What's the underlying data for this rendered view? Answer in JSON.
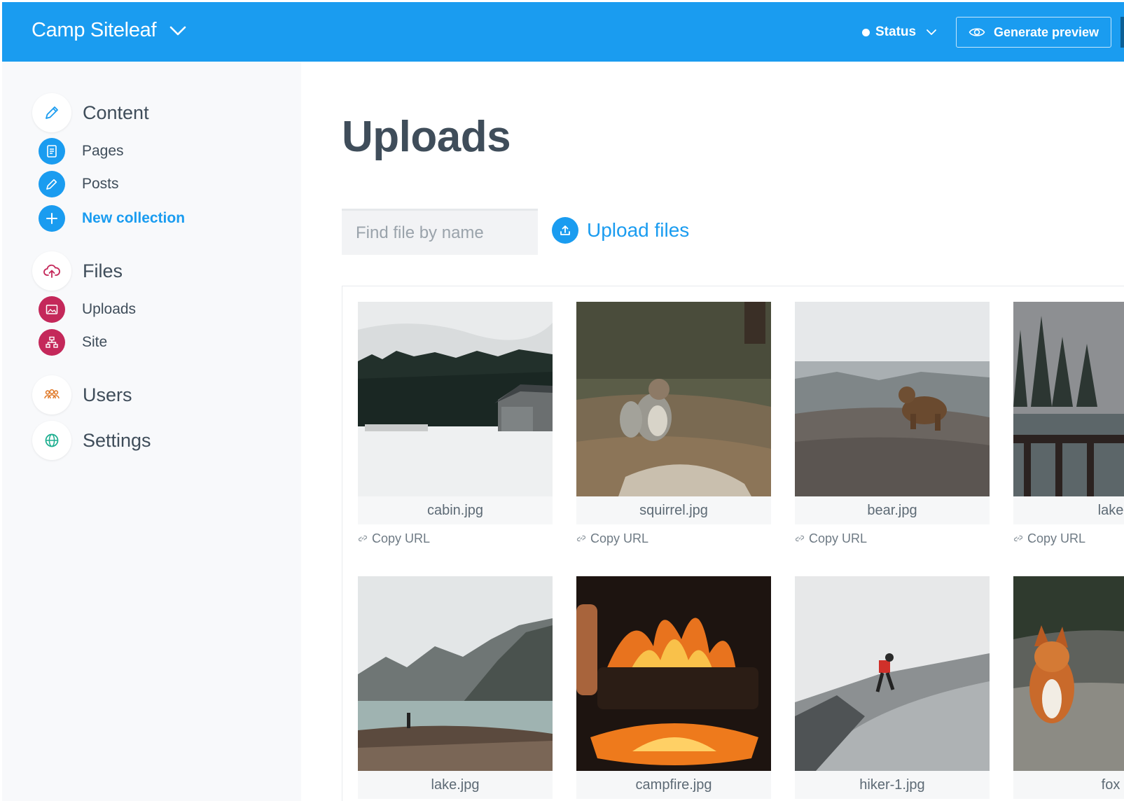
{
  "topbar": {
    "site_name": "Camp Siteleaf",
    "status_label": "Status",
    "preview_label": "Generate preview"
  },
  "sidebar": {
    "content": {
      "label": "Content",
      "items": [
        {
          "label": "Pages"
        },
        {
          "label": "Posts"
        },
        {
          "label": "New collection"
        }
      ]
    },
    "files": {
      "label": "Files",
      "items": [
        {
          "label": "Uploads"
        },
        {
          "label": "Site"
        }
      ]
    },
    "users": {
      "label": "Users"
    },
    "settings": {
      "label": "Settings"
    }
  },
  "main": {
    "title": "Uploads",
    "search_placeholder": "Find file by name",
    "upload_label": "Upload files",
    "copy_url_label": "Copy URL",
    "files": [
      {
        "name": "cabin.jpg"
      },
      {
        "name": "squirrel.jpg"
      },
      {
        "name": "bear.jpg"
      },
      {
        "name": "lake"
      },
      {
        "name": "lake.jpg"
      },
      {
        "name": "campfire.jpg"
      },
      {
        "name": "hiker-1.jpg"
      },
      {
        "name": "fox"
      }
    ]
  },
  "colors": {
    "accent": "#1a9cf0",
    "files_accent": "#c4285a",
    "users_accent": "#e07a2a",
    "settings_accent": "#1cae8f"
  }
}
